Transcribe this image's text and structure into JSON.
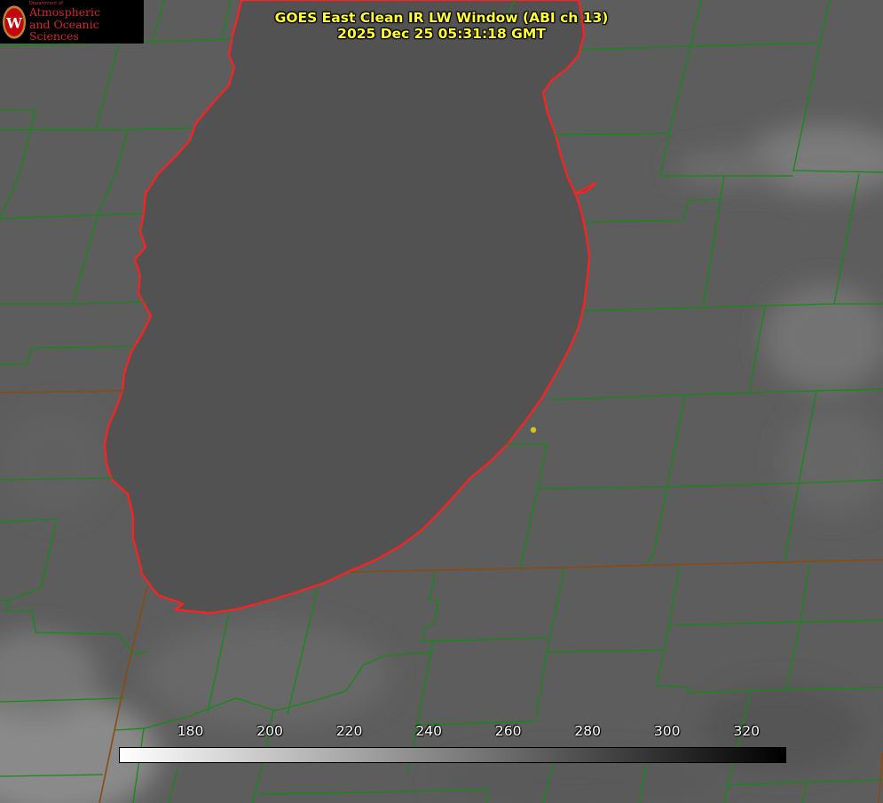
{
  "title": {
    "line1": "GOES East Clean IR LW Window (ABI ch 13)",
    "line2": "2025 Dec 25 05:31:18 GMT"
  },
  "logo": {
    "crest_letter": "W",
    "department": "Department of",
    "line1": "Atmospheric",
    "line2": "and Oceanic Sciences"
  },
  "colorbar": {
    "tick_labels": [
      "180",
      "200",
      "220",
      "240",
      "260",
      "280",
      "300",
      "320"
    ],
    "tick_values": [
      180,
      200,
      220,
      240,
      260,
      280,
      300,
      320
    ],
    "range": [
      162,
      330
    ],
    "gradient": [
      "#ffffff",
      "#000000"
    ]
  },
  "colors": {
    "county_lines": "#138b13",
    "state_lines": "#8a4a12",
    "lake_outline": "#ff2020",
    "station_dot": "#d7c419",
    "title": "#ffff33"
  }
}
